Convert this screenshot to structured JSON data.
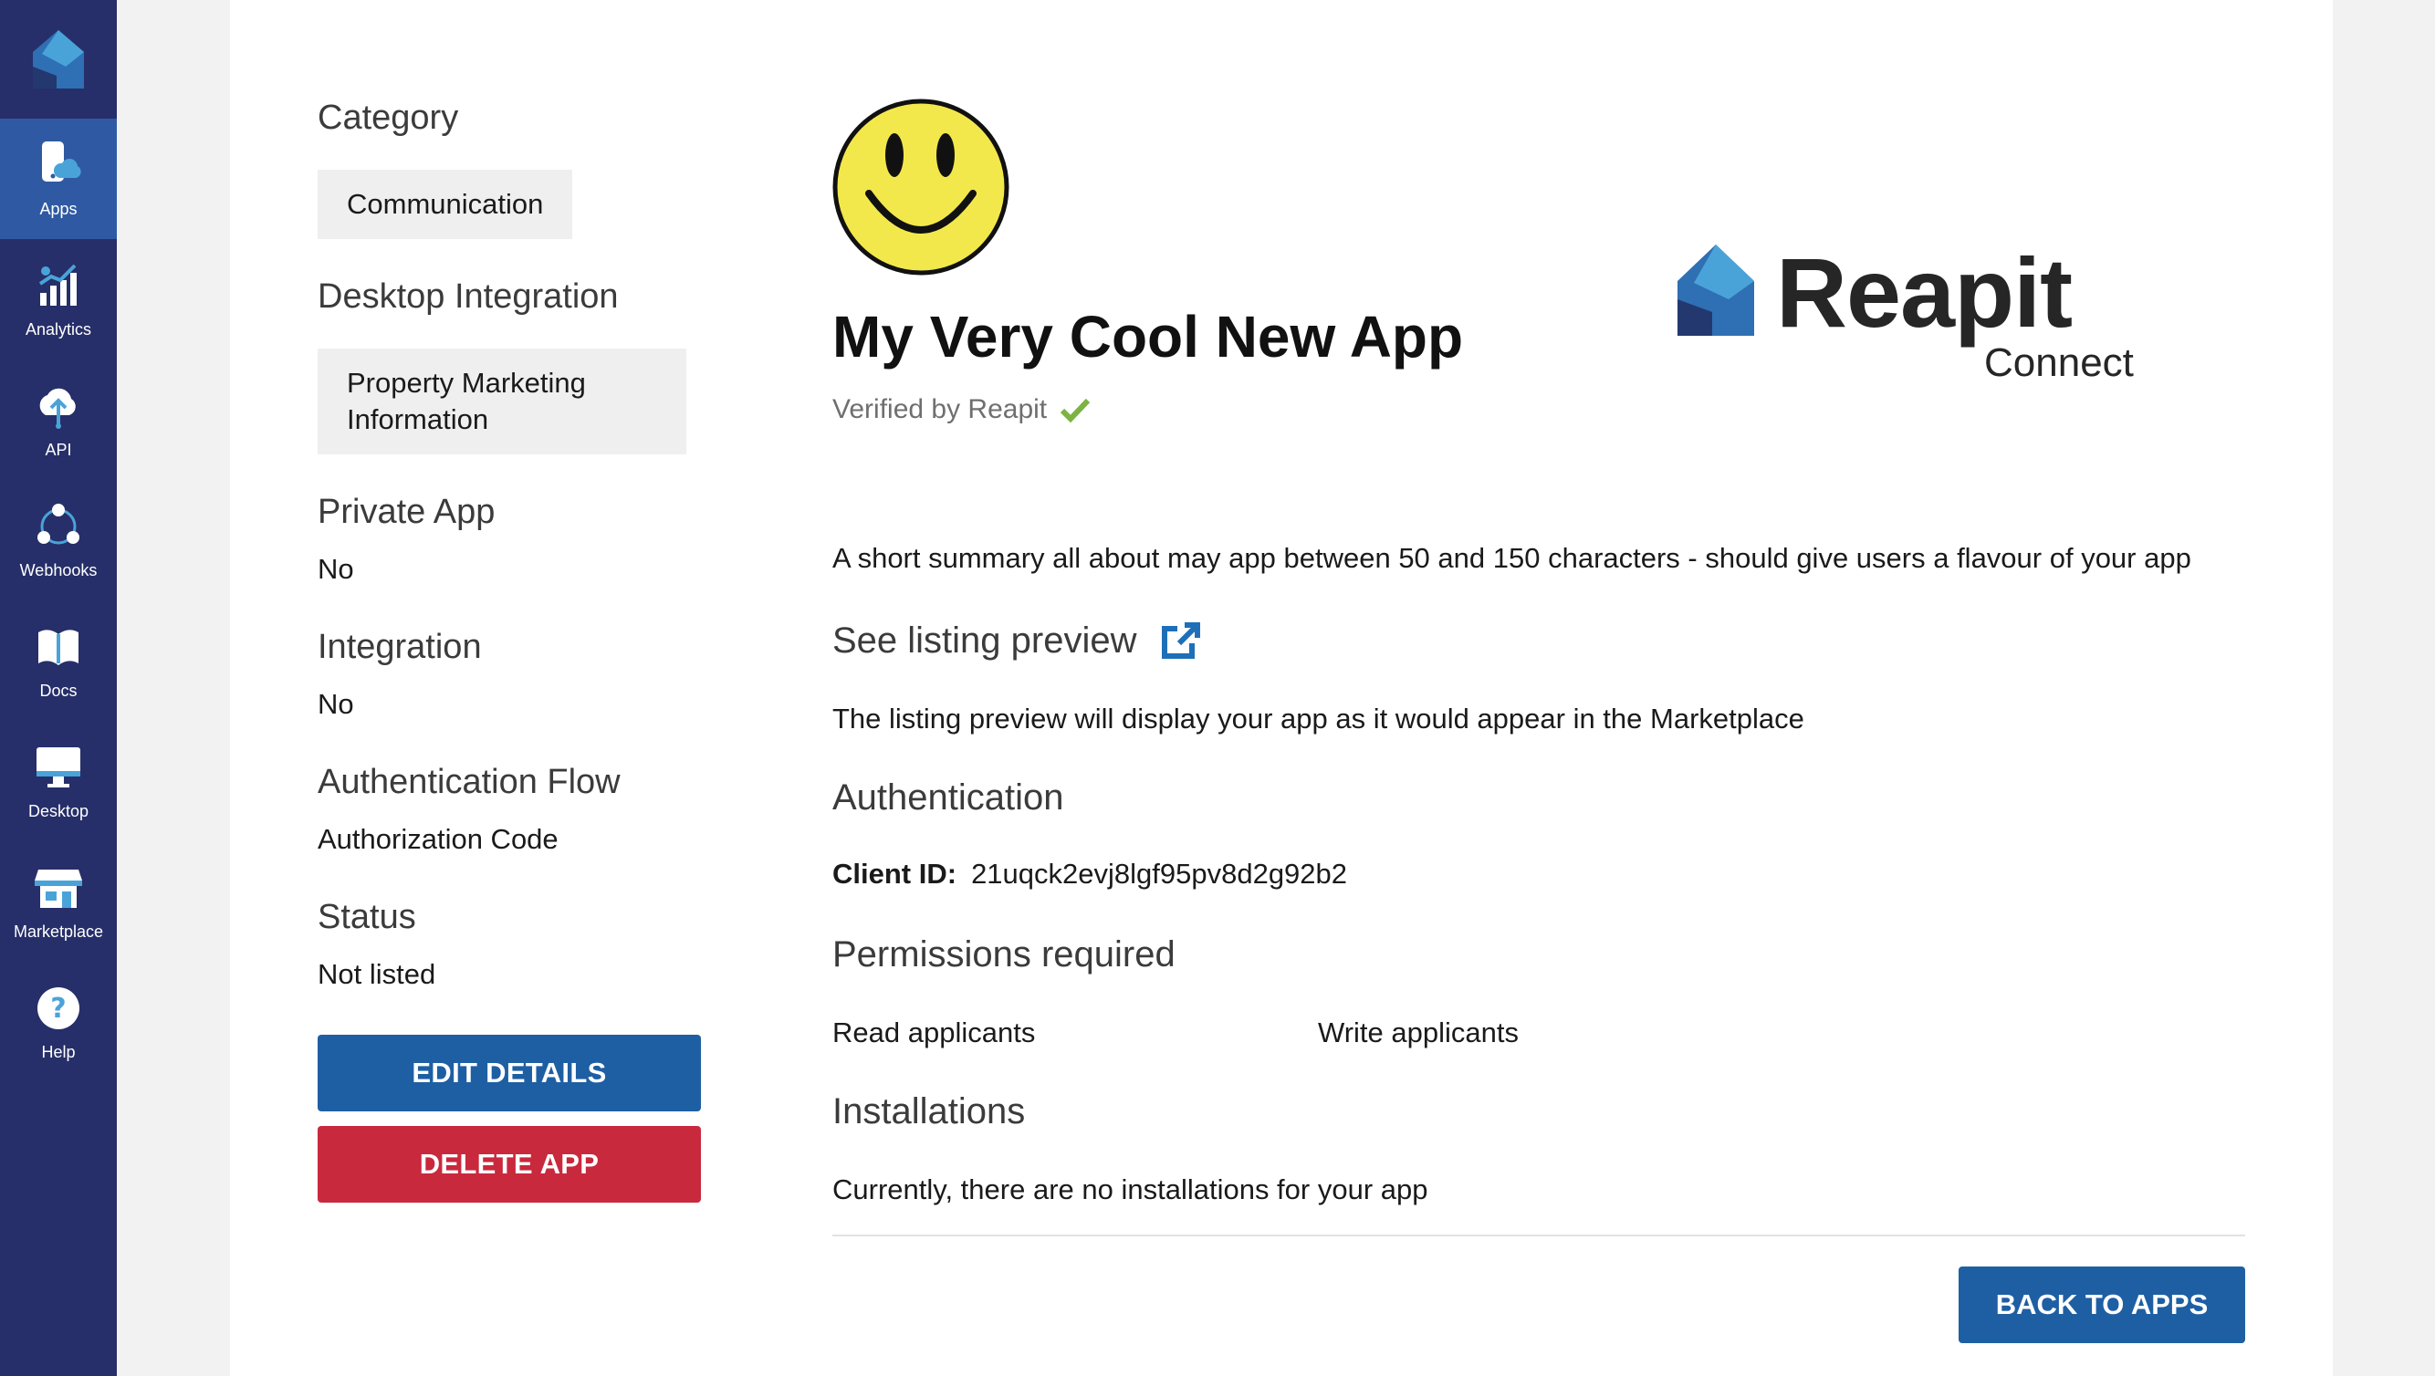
{
  "sidebar": {
    "items": [
      {
        "label": "Apps",
        "icon": "apps-phone-cloud-icon",
        "active": true
      },
      {
        "label": "Analytics",
        "icon": "analytics-chart-icon"
      },
      {
        "label": "API",
        "icon": "api-cloud-icon"
      },
      {
        "label": "Webhooks",
        "icon": "webhooks-icon"
      },
      {
        "label": "Docs",
        "icon": "docs-book-icon"
      },
      {
        "label": "Desktop",
        "icon": "desktop-monitor-icon"
      },
      {
        "label": "Marketplace",
        "icon": "marketplace-store-icon"
      },
      {
        "label": "Help",
        "icon": "help-question-icon"
      }
    ]
  },
  "details": {
    "category_title": "Category",
    "category_value": "Communication",
    "desktop_integration_title": "Desktop Integration",
    "desktop_integration_value": "Property Marketing Information",
    "private_app_title": "Private App",
    "private_app_value": "No",
    "integration_title": "Integration",
    "integration_value": "No",
    "auth_flow_title": "Authentication Flow",
    "auth_flow_value": "Authorization Code",
    "status_title": "Status",
    "status_value": "Not listed",
    "edit_button": "EDIT DETAILS",
    "delete_button": "DELETE APP"
  },
  "app": {
    "name": "My Very Cool New App",
    "verified_text": "Verified by Reapit",
    "brand_name": "Reapit",
    "brand_sub": "Connect",
    "summary": "A short summary all about may app between 50 and 150 characters - should give users a flavour of your app",
    "listing_preview_title": "See listing preview",
    "listing_preview_text": "The listing preview will display your app as it would appear in the Marketplace",
    "authentication_title": "Authentication",
    "client_id_label": "Client ID:",
    "client_id_value": "21uqck2evj8lgf95pv8d2g92b2",
    "permissions_title": "Permissions required",
    "permissions": [
      "Read applicants",
      "Write applicants"
    ],
    "installations_title": "Installations",
    "installations_text": "Currently, there are no installations for your app",
    "back_button": "BACK TO APPS"
  },
  "colors": {
    "sidebar_bg": "#262f69",
    "sidebar_active": "#2f5aa3",
    "primary_button": "#1e5fa3",
    "danger_button": "#c8293d",
    "verified_check": "#7cb342"
  }
}
